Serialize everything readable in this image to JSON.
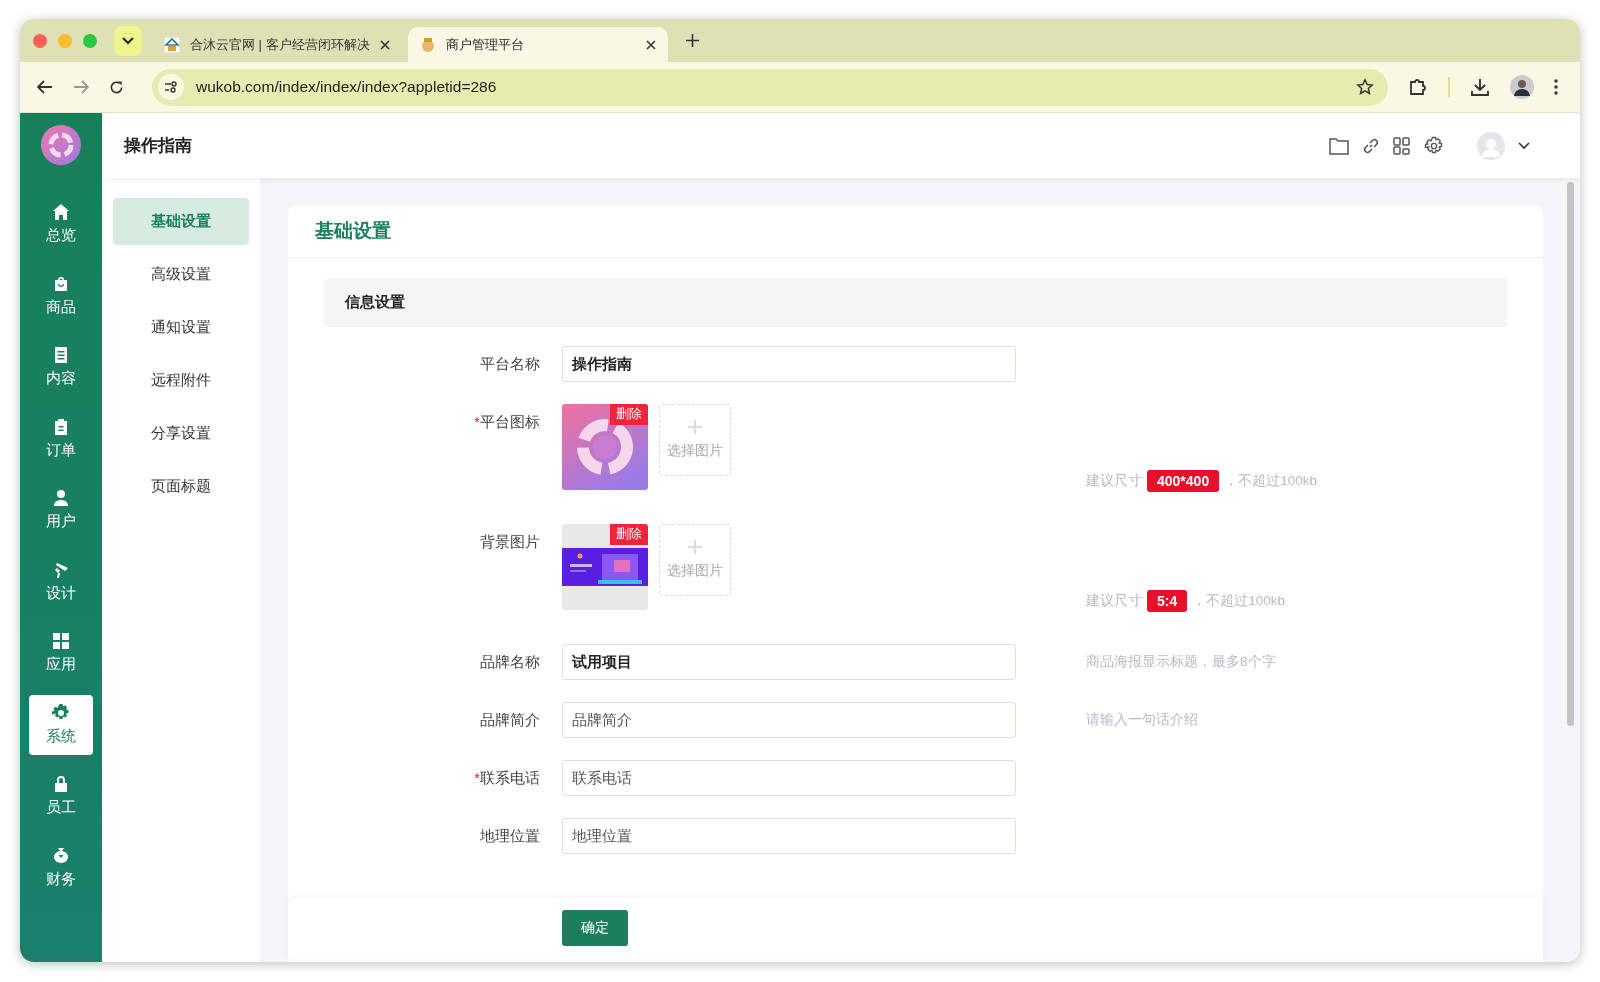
{
  "browser": {
    "tabs": [
      {
        "title": "合沐云官网 | 客户经营闭环解决",
        "selected": false
      },
      {
        "title": "商户管理平台",
        "selected": true
      }
    ],
    "address": "wukob.com/index/index/index?appletid=286"
  },
  "header": {
    "title": "操作指南"
  },
  "sidebar": {
    "items": [
      {
        "label": "总览",
        "selected": false
      },
      {
        "label": "商品",
        "selected": false
      },
      {
        "label": "内容",
        "selected": false
      },
      {
        "label": "订单",
        "selected": false
      },
      {
        "label": "用户",
        "selected": false
      },
      {
        "label": "设计",
        "selected": false
      },
      {
        "label": "应用",
        "selected": false
      },
      {
        "label": "系统",
        "selected": true
      },
      {
        "label": "员工",
        "selected": false
      },
      {
        "label": "财务",
        "selected": false
      }
    ]
  },
  "submenu": [
    {
      "label": "基础设置",
      "selected": true
    },
    {
      "label": "高级设置",
      "selected": false
    },
    {
      "label": "通知设置",
      "selected": false
    },
    {
      "label": "远程附件",
      "selected": false
    },
    {
      "label": "分享设置",
      "selected": false
    },
    {
      "label": "页面标题",
      "selected": false
    }
  ],
  "card": {
    "title": "基础设置",
    "section": "信息设置",
    "rows": [
      {
        "kind": "input",
        "label": "平台名称",
        "value": "操作指南"
      },
      {
        "label": "平台图标",
        "required_mark": "*",
        "delete": "删除",
        "add": "选择图片",
        "hint_before": "建议尺寸",
        "size": "400*400",
        "hint_after": "，不超过100kb"
      },
      {
        "label": "背景图片",
        "delete": "删除",
        "add": "选择图片",
        "hint_before": "建议尺寸",
        "size": "5:4",
        "hint_after": "，不超过100kb"
      },
      {
        "kind": "input",
        "label": "品牌名称",
        "value": "试用项目",
        "hint": "商品海报显示标题，最多8个字"
      },
      {
        "kind": "input",
        "label": "品牌简介",
        "placeholder": "品牌简介",
        "hint": "请输入一句话介绍"
      },
      {
        "kind": "input",
        "label": "联系电话",
        "required_mark": "*",
        "placeholder": "联系电话"
      },
      {
        "kind": "input",
        "label": "地理位置",
        "placeholder": "地理位置"
      }
    ],
    "submit": "确定"
  }
}
